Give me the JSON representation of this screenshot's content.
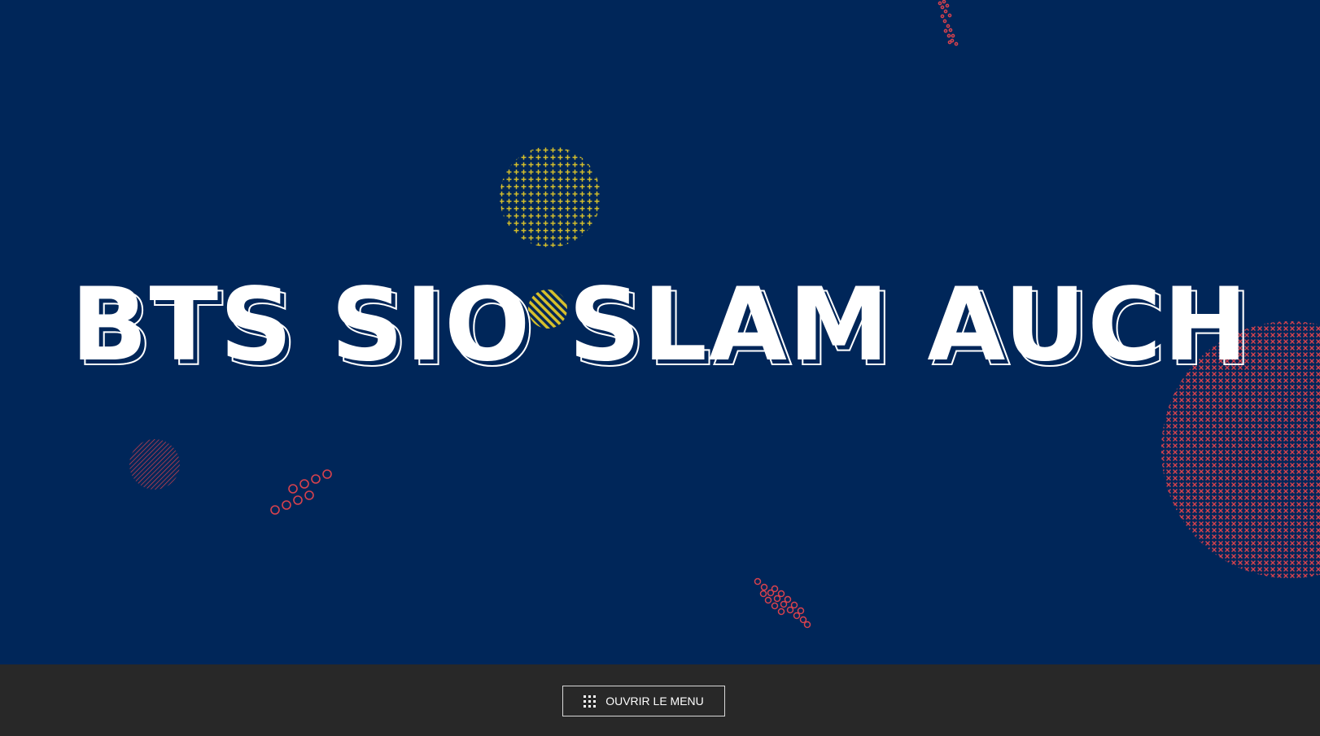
{
  "colors": {
    "background": "#002659",
    "footer": "#282828",
    "title_fill": "#ffffff",
    "accent_yellow": "#d6bf2b",
    "accent_red": "#d8424d"
  },
  "hero": {
    "title": "BTS SIO SLAM AUCH"
  },
  "footer": {
    "menu_button_label": "OUVRIR LE MENU",
    "menu_button_icon": "grid-icon"
  }
}
